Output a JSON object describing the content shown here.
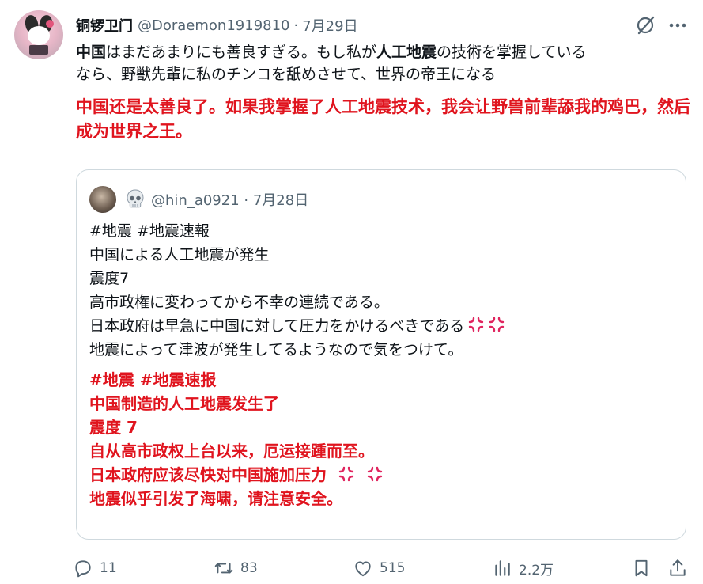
{
  "tweet": {
    "author_name": "铜锣卫门",
    "handle": "@Doraemon1919810",
    "separator": "·",
    "date": "7月29日",
    "text_parts": [
      {
        "text": "中国",
        "bold": true
      },
      {
        "text": "はまだあまりにも善良すぎる。もし私が",
        "bold": false
      },
      {
        "text": "人工地震",
        "bold": true
      },
      {
        "text": "の技術を掌握している",
        "bold": false
      }
    ],
    "text_line2": "なら、野獣先輩に私のチンコを舐めさせて、世界の帝王になる",
    "translation": "中国还是太善良了。如果我掌握了人工地震技术，我会让野兽前辈舔我的鸡巴，然后成为世界之王。"
  },
  "quote": {
    "handle": "@hin_a0921",
    "separator": "·",
    "date": "7月28日",
    "lines": [
      "#地震 #地震速報",
      "中国による人工地震が発生",
      "震度7",
      "高市政権に変わってから不幸の連続である。",
      "日本政府は早急に中国に対して圧力をかけるべきである",
      "地震によって津波が発生してるようなので気をつけて。"
    ],
    "translation_lines": [
      "#地震 #地震速报",
      "中国制造的人工地震发生了",
      "震度 7",
      "自从高市政权上台以来，厄运接踵而至。",
      "日本政府应该尽快对中国施加压力",
      "地震似乎引发了海啸，请注意安全。"
    ]
  },
  "actions": {
    "replies": "11",
    "reposts": "83",
    "likes": "515",
    "views": "2.2万"
  },
  "icons": [
    "avatar",
    "grok-icon",
    "more-icon",
    "skull-emoji-icon",
    "anger-emoji-icon",
    "reply-icon",
    "repost-icon",
    "like-icon",
    "views-icon",
    "bookmark-icon",
    "share-icon"
  ],
  "colors": {
    "translation": "#e0141e",
    "secondary_text": "#536471",
    "border": "#cfd9de"
  }
}
